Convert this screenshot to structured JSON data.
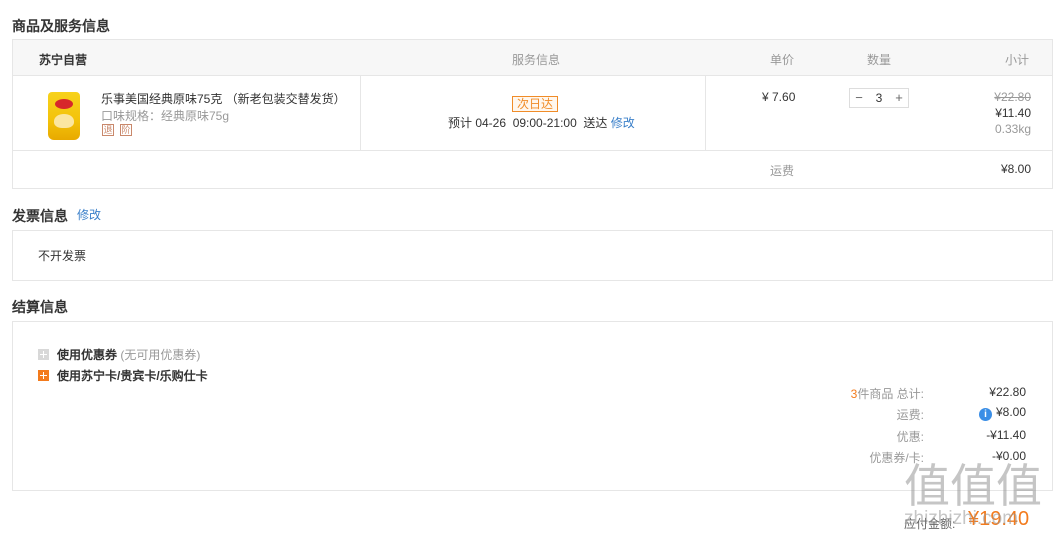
{
  "goods_section": {
    "title": "商品及服务信息",
    "headers": {
      "store": "苏宁自营",
      "service": "服务信息",
      "unit_price": "单价",
      "quantity": "数量",
      "subtotal": "小计"
    },
    "item": {
      "name": "乐事美国经典原味75克 （新老包装交替发货）",
      "spec": "口味规格：经典原味75g",
      "service_icons": [
        "退",
        "阶"
      ],
      "delivery_tag": "次日达",
      "eta": "预计 04-26  09:00-21:00  送达",
      "eta_edit": "修改",
      "unit_price": "¥ 7.60",
      "quantity": "3",
      "minus": "−",
      "plus": "+",
      "original_subtotal": "¥22.80",
      "subtotal": "¥11.40",
      "weight": "0.33kg"
    },
    "freight_label": "运费",
    "freight_value": "¥8.00"
  },
  "invoice_section": {
    "title": "发票信息",
    "edit": "修改",
    "value": "不开发票"
  },
  "settlement_section": {
    "title": "结算信息",
    "coupon_label": "使用优惠券",
    "coupon_note": "(无可用优惠券)",
    "card_label": "使用苏宁卡/贵宾卡/乐购仕卡",
    "items_count": "3",
    "items_total_label": "件商品 总计:",
    "items_total": "¥22.80",
    "freight_label": "运费:",
    "freight": "¥8.00",
    "discount_label": "优惠:",
    "discount": "-¥11.40",
    "coupon_card_label": "优惠券/卡:",
    "coupon_card": "-¥0.00",
    "payable_label": "应付金额:",
    "payable": "¥19.40"
  },
  "watermark": {
    "chars": "值值值",
    "site": "zhizhizhi.com"
  },
  "colors": {
    "accent": "#f37b1d",
    "link": "#3a7fc9",
    "border": "#e6e6e6"
  }
}
